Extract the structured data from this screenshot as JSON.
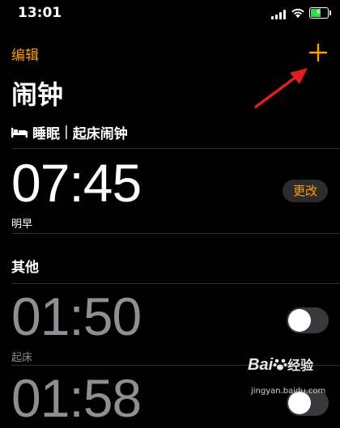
{
  "status_bar": {
    "time": "13:01"
  },
  "nav": {
    "edit_label": "编辑",
    "add_icon": "plus-icon"
  },
  "page": {
    "title": "闹钟"
  },
  "sleep_section": {
    "icon": "bed-icon",
    "label": "睡眠",
    "separator": "|",
    "sublabel": "起床闹钟"
  },
  "sleep_alarm": {
    "time": "07:45",
    "label": "明早",
    "change_button": "更改"
  },
  "others_section": {
    "title": "其他"
  },
  "alarms": [
    {
      "time": "01:50",
      "label": "起床",
      "enabled": false
    },
    {
      "time": "01:58",
      "label": "",
      "enabled": false
    }
  ],
  "watermark": {
    "brand": "Bai",
    "brand_cn": "经验",
    "url": "jingyan.baidu.com"
  },
  "colors": {
    "accent": "#ff9f0a",
    "background": "#000000",
    "disabled_text": "#8e8e93",
    "annotation_arrow": "#e02020"
  }
}
